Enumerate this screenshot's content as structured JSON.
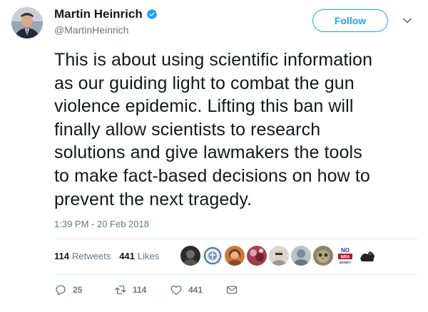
{
  "user": {
    "name": "Martin Heinrich",
    "handle": "@MartinHeinrich",
    "verified": true
  },
  "follow_label": "Follow",
  "tweet": {
    "lines": [
      "This is about using scientific information",
      "as our guiding light to combat the gun",
      "violence epidemic. Lifting this ban will",
      "finally allow scientists to research",
      "solutions and give lawmakers the tools",
      "to make fact-based decisions on how to",
      "prevent the next tragedy."
    ],
    "timestamp": "1:39 PM - 20 Feb 2018"
  },
  "stats": {
    "retweets_count": "114",
    "retweets_label": "Retweets",
    "likes_count": "441",
    "likes_label": "Likes"
  },
  "liker_badge_text": "NO NRA MONEY",
  "actions": {
    "reply_count": "25",
    "retweet_count": "114",
    "like_count": "441"
  },
  "colors": {
    "accent": "#1da1f2",
    "text": "#14171a",
    "muted": "#657786",
    "divider": "#e6ecf0"
  },
  "icons": [
    "verified-badge-icon",
    "chevron-down-icon",
    "reply-icon",
    "retweet-icon",
    "like-icon",
    "message-icon"
  ]
}
